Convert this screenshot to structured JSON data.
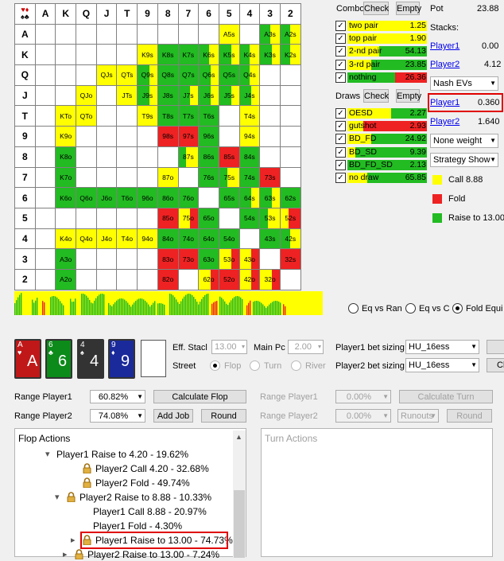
{
  "grid": {
    "ranks": [
      "A",
      "K",
      "Q",
      "J",
      "T",
      "9",
      "8",
      "7",
      "6",
      "5",
      "4",
      "3",
      "2"
    ],
    "cells": {
      "0_9": "A5s",
      "0_11": "A3s",
      "0_12": "A2s",
      "1_5": "K9s",
      "1_6": "K8s",
      "1_7": "K7s",
      "1_8": "K6s",
      "1_9": "K5s",
      "1_10": "K4s",
      "1_11": "K3s",
      "1_12": "K2s",
      "2_3": "QJs",
      "2_4": "QTs",
      "2_5": "Q9s",
      "2_6": "Q8s",
      "2_7": "Q7s",
      "2_8": "Q6s",
      "2_9": "Q5s",
      "2_10": "Q4s",
      "3_2": "QJo",
      "3_4": "JTs",
      "3_5": "J9s",
      "3_6": "J8s",
      "3_7": "J7s",
      "3_8": "J6s",
      "3_9": "J5s",
      "3_10": "J4s",
      "4_1": "KTo",
      "4_2": "QTo",
      "4_5": "T9s",
      "4_6": "T8s",
      "4_7": "T7s",
      "4_8": "T6s",
      "4_10": "T4s",
      "5_1": "K9o",
      "5_6": "98s",
      "5_7": "97s",
      "5_8": "96s",
      "5_10": "94s",
      "6_1": "K8o",
      "6_7": "87s",
      "6_8": "86s",
      "6_9": "85s",
      "6_10": "84s",
      "7_1": "K7o",
      "7_6": "87o",
      "7_8": "76s",
      "7_9": "75s",
      "7_10": "74s",
      "7_11": "73s",
      "8_1": "K6o",
      "8_2": "Q6o",
      "8_3": "J6o",
      "8_4": "T6o",
      "8_5": "96o",
      "8_6": "86o",
      "8_7": "76o",
      "8_9": "65s",
      "8_10": "64s",
      "8_11": "63s",
      "8_12": "62s",
      "9_6": "85o",
      "9_7": "75o",
      "9_8": "65o",
      "9_10": "54s",
      "9_11": "53s",
      "9_12": "52s",
      "10_1": "K4o",
      "10_2": "Q4o",
      "10_3": "J4o",
      "10_4": "T4o",
      "10_5": "94o",
      "10_6": "84o",
      "10_7": "74o",
      "10_8": "64o",
      "10_9": "54o",
      "10_11": "43s",
      "10_12": "42s",
      "11_1": "A3o",
      "11_6": "83o",
      "11_7": "73o",
      "11_8": "63o",
      "11_9": "53o",
      "11_10": "43o",
      "11_12": "32s",
      "12_1": "A2o",
      "12_6": "82o",
      "12_8": "62o",
      "12_9": "52o",
      "12_10": "42o",
      "12_11": "32o"
    }
  },
  "combo": {
    "title": "Combo",
    "check": "Check",
    "empty": "Empty",
    "rows": [
      {
        "label": "two pair",
        "value": "1.25"
      },
      {
        "label": "top pair",
        "value": "1.90"
      },
      {
        "label": "2-nd pair",
        "value": "54.13"
      },
      {
        "label": "3-rd pair",
        "value": "23.85"
      },
      {
        "label": "nothing",
        "value": "26.36"
      }
    ]
  },
  "draws": {
    "title": "Draws",
    "check": "Check",
    "empty": "Empty",
    "rows": [
      {
        "label": "OESD",
        "value": "2.27"
      },
      {
        "label": "gutshot",
        "value": "2.93"
      },
      {
        "label": "BD_FD",
        "value": "24.92"
      },
      {
        "label": "BD_SD",
        "value": "9.39"
      },
      {
        "label": "BD_FD_SD",
        "value": "2.13"
      },
      {
        "label": "no draw",
        "value": "65.85"
      }
    ]
  },
  "pot": {
    "label": "Pot",
    "value": "23.88"
  },
  "stacks": {
    "label": "Stacks:",
    "p1": "Player1",
    "p1v": "0.00",
    "p2": "Player2",
    "p2v": "4.12"
  },
  "ev": {
    "select": "Nash EVs",
    "p1": "Player1",
    "p1v": "0.360",
    "p2": "Player2",
    "p2v": "1.640"
  },
  "weight_select": "None weight",
  "strategy_select": "Strategy Show",
  "legend": [
    {
      "label": "Call 8.88",
      "color": "#ffff00"
    },
    {
      "label": "Fold",
      "color": "#ee2222"
    },
    {
      "label": "Raise to 13.00",
      "color": "#22bb22"
    }
  ],
  "eq_radios": [
    "Eq vs Ran",
    "Eq vs C",
    "Fold Equi"
  ],
  "cards": [
    {
      "rank": "A",
      "suit": "♥",
      "bg": "#c01818"
    },
    {
      "rank": "6",
      "suit": "♣",
      "bg": "#0c8a1a"
    },
    {
      "rank": "4",
      "suit": "♠",
      "bg": "#333333"
    },
    {
      "rank": "9",
      "suit": "♦",
      "bg": "#1a2a9a"
    }
  ],
  "eff_stack": {
    "label": "Eff. Stacl",
    "value": "13.00"
  },
  "main_pot": {
    "label": "Main Pc",
    "value": "2.00"
  },
  "street": {
    "label": "Street",
    "opts": [
      "Flop",
      "Turn",
      "River"
    ]
  },
  "bet_sizing": {
    "p1_label": "Player1 bet sizing",
    "p1_value": "HU_16ess",
    "p2_label": "Player2 bet sizing",
    "p2_value": "HU_16ess",
    "btn2": "Cl"
  },
  "range": {
    "p1_label": "Range Player1",
    "p1_value": "60.82%",
    "p2_label": "Range Player2",
    "p2_value": "74.08%",
    "calc_flop": "Calculate Flop",
    "add_job": "Add Job",
    "round": "Round",
    "p1_label_r": "Range Player1",
    "p1_value_r": "0.00%",
    "p2_label_r": "Range Player2",
    "p2_value_r": "0.00%",
    "calc_turn": "Calculate Turn",
    "runouts": "Runouts",
    "round_r": "Round"
  },
  "flop_actions": {
    "title": "Flop Actions",
    "items": [
      "Player1 Raise to 4.20 - 19.62%",
      "Player2 Call 4.20 - 32.68%",
      "Player2 Fold - 49.74%",
      "Player2 Raise to 8.88 - 10.33%",
      "Player1 Call 8.88 - 20.97%",
      "Player1 Fold - 4.30%",
      "Player1 Raise to 13.00 - 74.73%",
      "Player2 Raise to 13.00 - 7.24%"
    ]
  },
  "turn_actions": {
    "title": "Turn Actions"
  }
}
